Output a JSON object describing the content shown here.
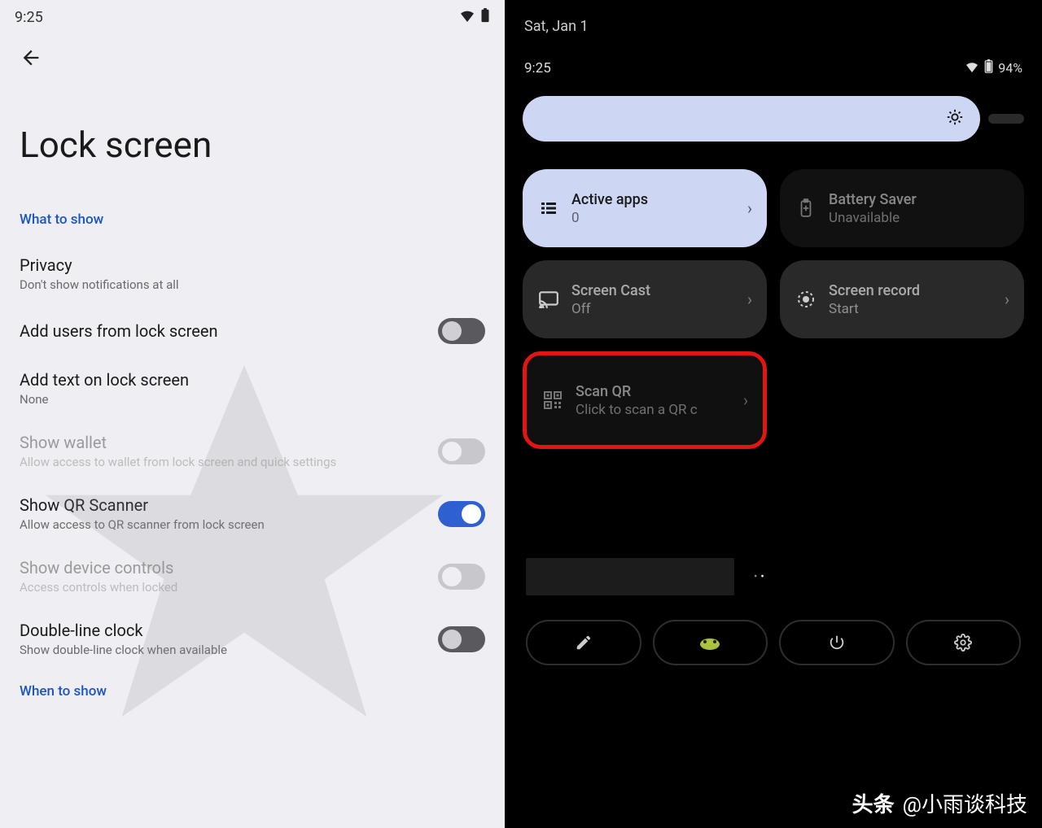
{
  "left": {
    "status_time": "9:25",
    "page_title": "Lock screen",
    "section1_label": "What to show",
    "privacy": {
      "title": "Privacy",
      "sub": "Don't show notifications at all"
    },
    "add_users": {
      "title": "Add users from lock screen"
    },
    "add_text": {
      "title": "Add text on lock screen",
      "sub": "None"
    },
    "show_wallet": {
      "title": "Show wallet",
      "sub": "Allow access to wallet from lock screen and quick settings"
    },
    "show_qr": {
      "title": "Show QR Scanner",
      "sub": "Allow access to QR scanner from lock screen"
    },
    "show_controls": {
      "title": "Show device controls",
      "sub": "Access controls when locked"
    },
    "double_clock": {
      "title": "Double-line clock",
      "sub": "Show double-line clock when available"
    },
    "section2_label": "When to show"
  },
  "right": {
    "date": "Sat, Jan 1",
    "status_time": "9:25",
    "battery_text": "94%",
    "tiles": {
      "active_apps": {
        "title": "Active apps",
        "sub": "0"
      },
      "battery_saver": {
        "title": "Battery Saver",
        "sub": "Unavailable"
      },
      "screen_cast": {
        "title": "Screen Cast",
        "sub": "Off"
      },
      "screen_record": {
        "title": "Screen record",
        "sub": "Start"
      },
      "scan_qr": {
        "title": "Scan QR",
        "sub": "Click to scan a QR c"
      }
    }
  },
  "footer": {
    "brand": "头条",
    "at": "@小雨谈科技"
  }
}
